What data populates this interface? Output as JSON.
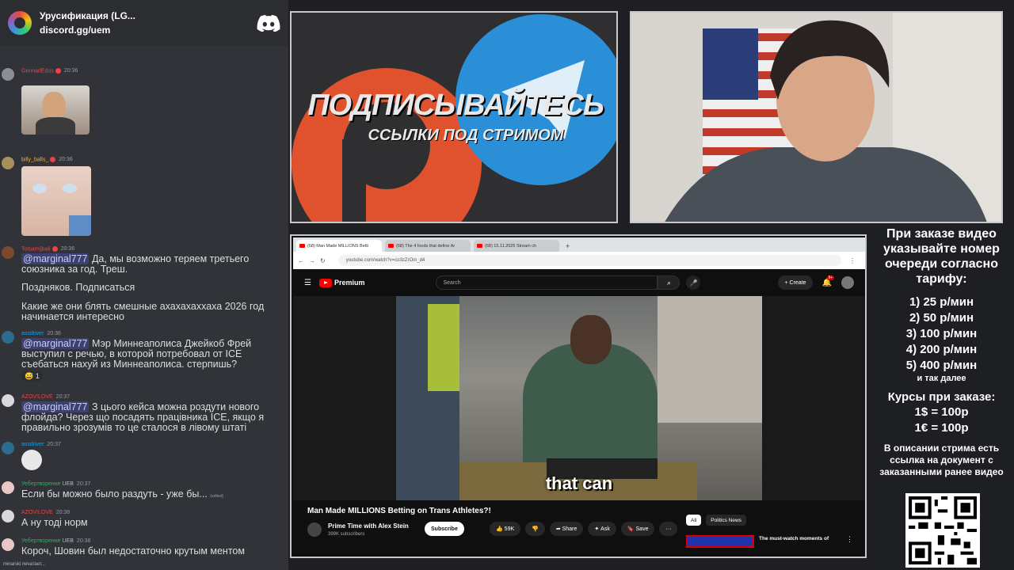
{
  "discord": {
    "server_title": "Урусификация (LG...",
    "invite": "discord.gg/uem",
    "messages": [
      {
        "user": "GennadEdus",
        "time": "20:36",
        "user_color": "#ed4245"
      },
      {
        "user": "billy_balls_",
        "time": "20:36",
        "user_color": "#f0b232"
      },
      {
        "user": "Totsamijbali",
        "time": "20:36",
        "user_color": "#ed4245",
        "mention": "@marginal777",
        "text": " Да, мы возможно теряем третьего союзника за год. Треш.",
        "extra1": "Поздняков. Подписаться",
        "extra2": "Какие же они блять смешные ахахахаххаха 2026 год начинается интересно"
      },
      {
        "user": "assdriver",
        "time": "20:36",
        "user_color": "#00a8fc",
        "mention": "@marginal777",
        "text": " Мэр Миннеаполиса Джейкоб Фрей выступил с речью, в которой потребовал от ICE съебаться нахуй из Миннеаполиса. стерпишь?",
        "reaction": "1"
      },
      {
        "user": "AZOV!LOVE",
        "time": "20:37",
        "user_color": "#ed4245",
        "mention": "@marginal777",
        "text": " З цього кейса можна роздути нового флойда? Через що посадять працівника ICE, якщо я правильно зрозумів то це сталося в лівому штаті"
      },
      {
        "user": "assdriver",
        "time": "20:37",
        "user_color": "#00a8fc"
      },
      {
        "user": "Уебертворение",
        "time": "20:37",
        "user_color": "#3ba55d",
        "tag": "UEB",
        "text": "Если бы можно было раздуть - уже бы...",
        "edited": "(edited)"
      },
      {
        "user": "AZOV!LOVE",
        "time": "20:38",
        "user_color": "#ed4245",
        "text": "А ну тоді норм"
      },
      {
        "user": "Уебертворение",
        "time": "20:38",
        "user_color": "#3ba55d",
        "tag": "UEB",
        "text": "Короч, Шовин был недостаточно крутым ментом"
      }
    ],
    "typing": "minarski печатает..."
  },
  "promo": {
    "headline": "ПОДПИСЫВАЙТЕСЬ",
    "subline": "ССЫЛКИ ПОД СТРИМОМ",
    "circle_left_color": "#e0522d",
    "circle_right_color": "#2a8fd6"
  },
  "browser": {
    "tabs": [
      {
        "label": "(68) Man Made MILLIONS Betti",
        "active": true
      },
      {
        "label": "(68) The 4 foods that define Ar",
        "active": false
      },
      {
        "label": "(68) 15.11.2025 Stream ch",
        "active": false
      }
    ],
    "url": "youtube.com/watch?v=co3zZrOm_d4"
  },
  "youtube": {
    "brand": "Premium",
    "search_placeholder": "Search",
    "create_label": "Create",
    "notif_count": "9+",
    "caption": "that can",
    "video_title": "Man Made MILLIONS Betting on Trans Athletes?!",
    "channel": "Prime Time with Alex Stein",
    "subscribers": "399K subscribers",
    "subscribe_label": "Subscribe",
    "likes": "59K",
    "share_label": "Share",
    "ask_label": "Ask",
    "save_label": "Save",
    "more_label": "···",
    "chips": [
      "All",
      "Politics News"
    ],
    "rec_title": "The must-watch moments of"
  },
  "info": {
    "heading": "При заказе видео указывайте номер очереди согласно тарифу:",
    "tariffs": [
      "1) 25 р/мин",
      "2) 50 р/мин",
      "3) 100 р/мин",
      "4) 200 р/мин",
      "5) 400 р/мин"
    ],
    "etc": "и так далее",
    "rates_title": "Курсы при заказе:",
    "rates": [
      "1$ = 100р",
      "1€ = 100р"
    ],
    "description": "В описании стрима есть ссылка на документ с заказанными ранее видео"
  }
}
